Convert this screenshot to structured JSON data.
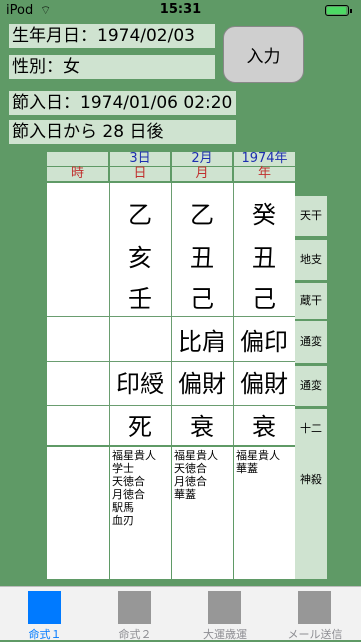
{
  "status": {
    "carrier": "iPod",
    "wifi": "⌔",
    "time": "15:31",
    "battery_level": 0.95
  },
  "form": {
    "birth": "生年月日：1974/02/03",
    "gender": "性別：女",
    "setsu": "節入日：1974/01/06 02:20",
    "setsu_after": "節入日から 28 日後",
    "input_button": "入力"
  },
  "columns": {
    "top": [
      "",
      "3日",
      "2月",
      "1974年"
    ],
    "bottom": [
      "時",
      "日",
      "月",
      "年"
    ]
  },
  "rows": [
    {
      "cells": [
        "",
        "乙",
        "乙",
        "癸"
      ],
      "label": "天干"
    },
    {
      "cells": [
        "",
        "亥",
        "丑",
        "丑"
      ],
      "label": "地支"
    },
    {
      "cells": [
        "",
        "壬",
        "己",
        "己"
      ],
      "label": "蔵干"
    },
    {
      "cells": [
        "",
        "",
        "比肩",
        "偏印"
      ],
      "label": "通変"
    },
    {
      "cells": [
        "",
        "印綬",
        "偏財",
        "偏財"
      ],
      "label": "通変"
    },
    {
      "cells": [
        "",
        "死",
        "衰",
        "衰"
      ],
      "label": "十二運"
    }
  ],
  "kamisatsu_label": "神殺",
  "kamisatsu": {
    "hour": [],
    "day": [
      "福星貴人",
      "学士",
      "天徳合",
      "月徳合",
      "駅馬",
      "血刃"
    ],
    "month": [
      "福星貴人",
      "天徳合",
      "月徳合",
      "華蓋"
    ],
    "year": [
      "福星貴人",
      "華蓋"
    ]
  },
  "tabs": [
    {
      "label": "命式１",
      "active": true
    },
    {
      "label": "命式２",
      "active": false
    },
    {
      "label": "大運歳運",
      "active": false
    },
    {
      "label": "メール送信",
      "active": false
    }
  ],
  "colors": {
    "background": "#5f9a66",
    "field": "#cfe3d0",
    "column_top": "#1e2fb0",
    "column_bottom": "#c0302e",
    "tab_active": "#007aff"
  }
}
